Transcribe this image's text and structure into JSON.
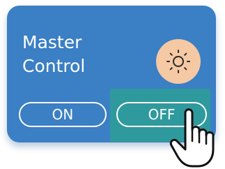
{
  "panel": {
    "title_line1": "Master",
    "title_line2": "Control",
    "icon": "sun-icon",
    "on_label": "ON",
    "off_label": "OFF"
  },
  "colors": {
    "card": "#3b7fc4",
    "sun_badge": "#f5c9a3",
    "highlight": "#2e9f96",
    "button_outline": "#ffffff"
  },
  "cursor": {
    "icon": "hand-pointer-icon"
  }
}
